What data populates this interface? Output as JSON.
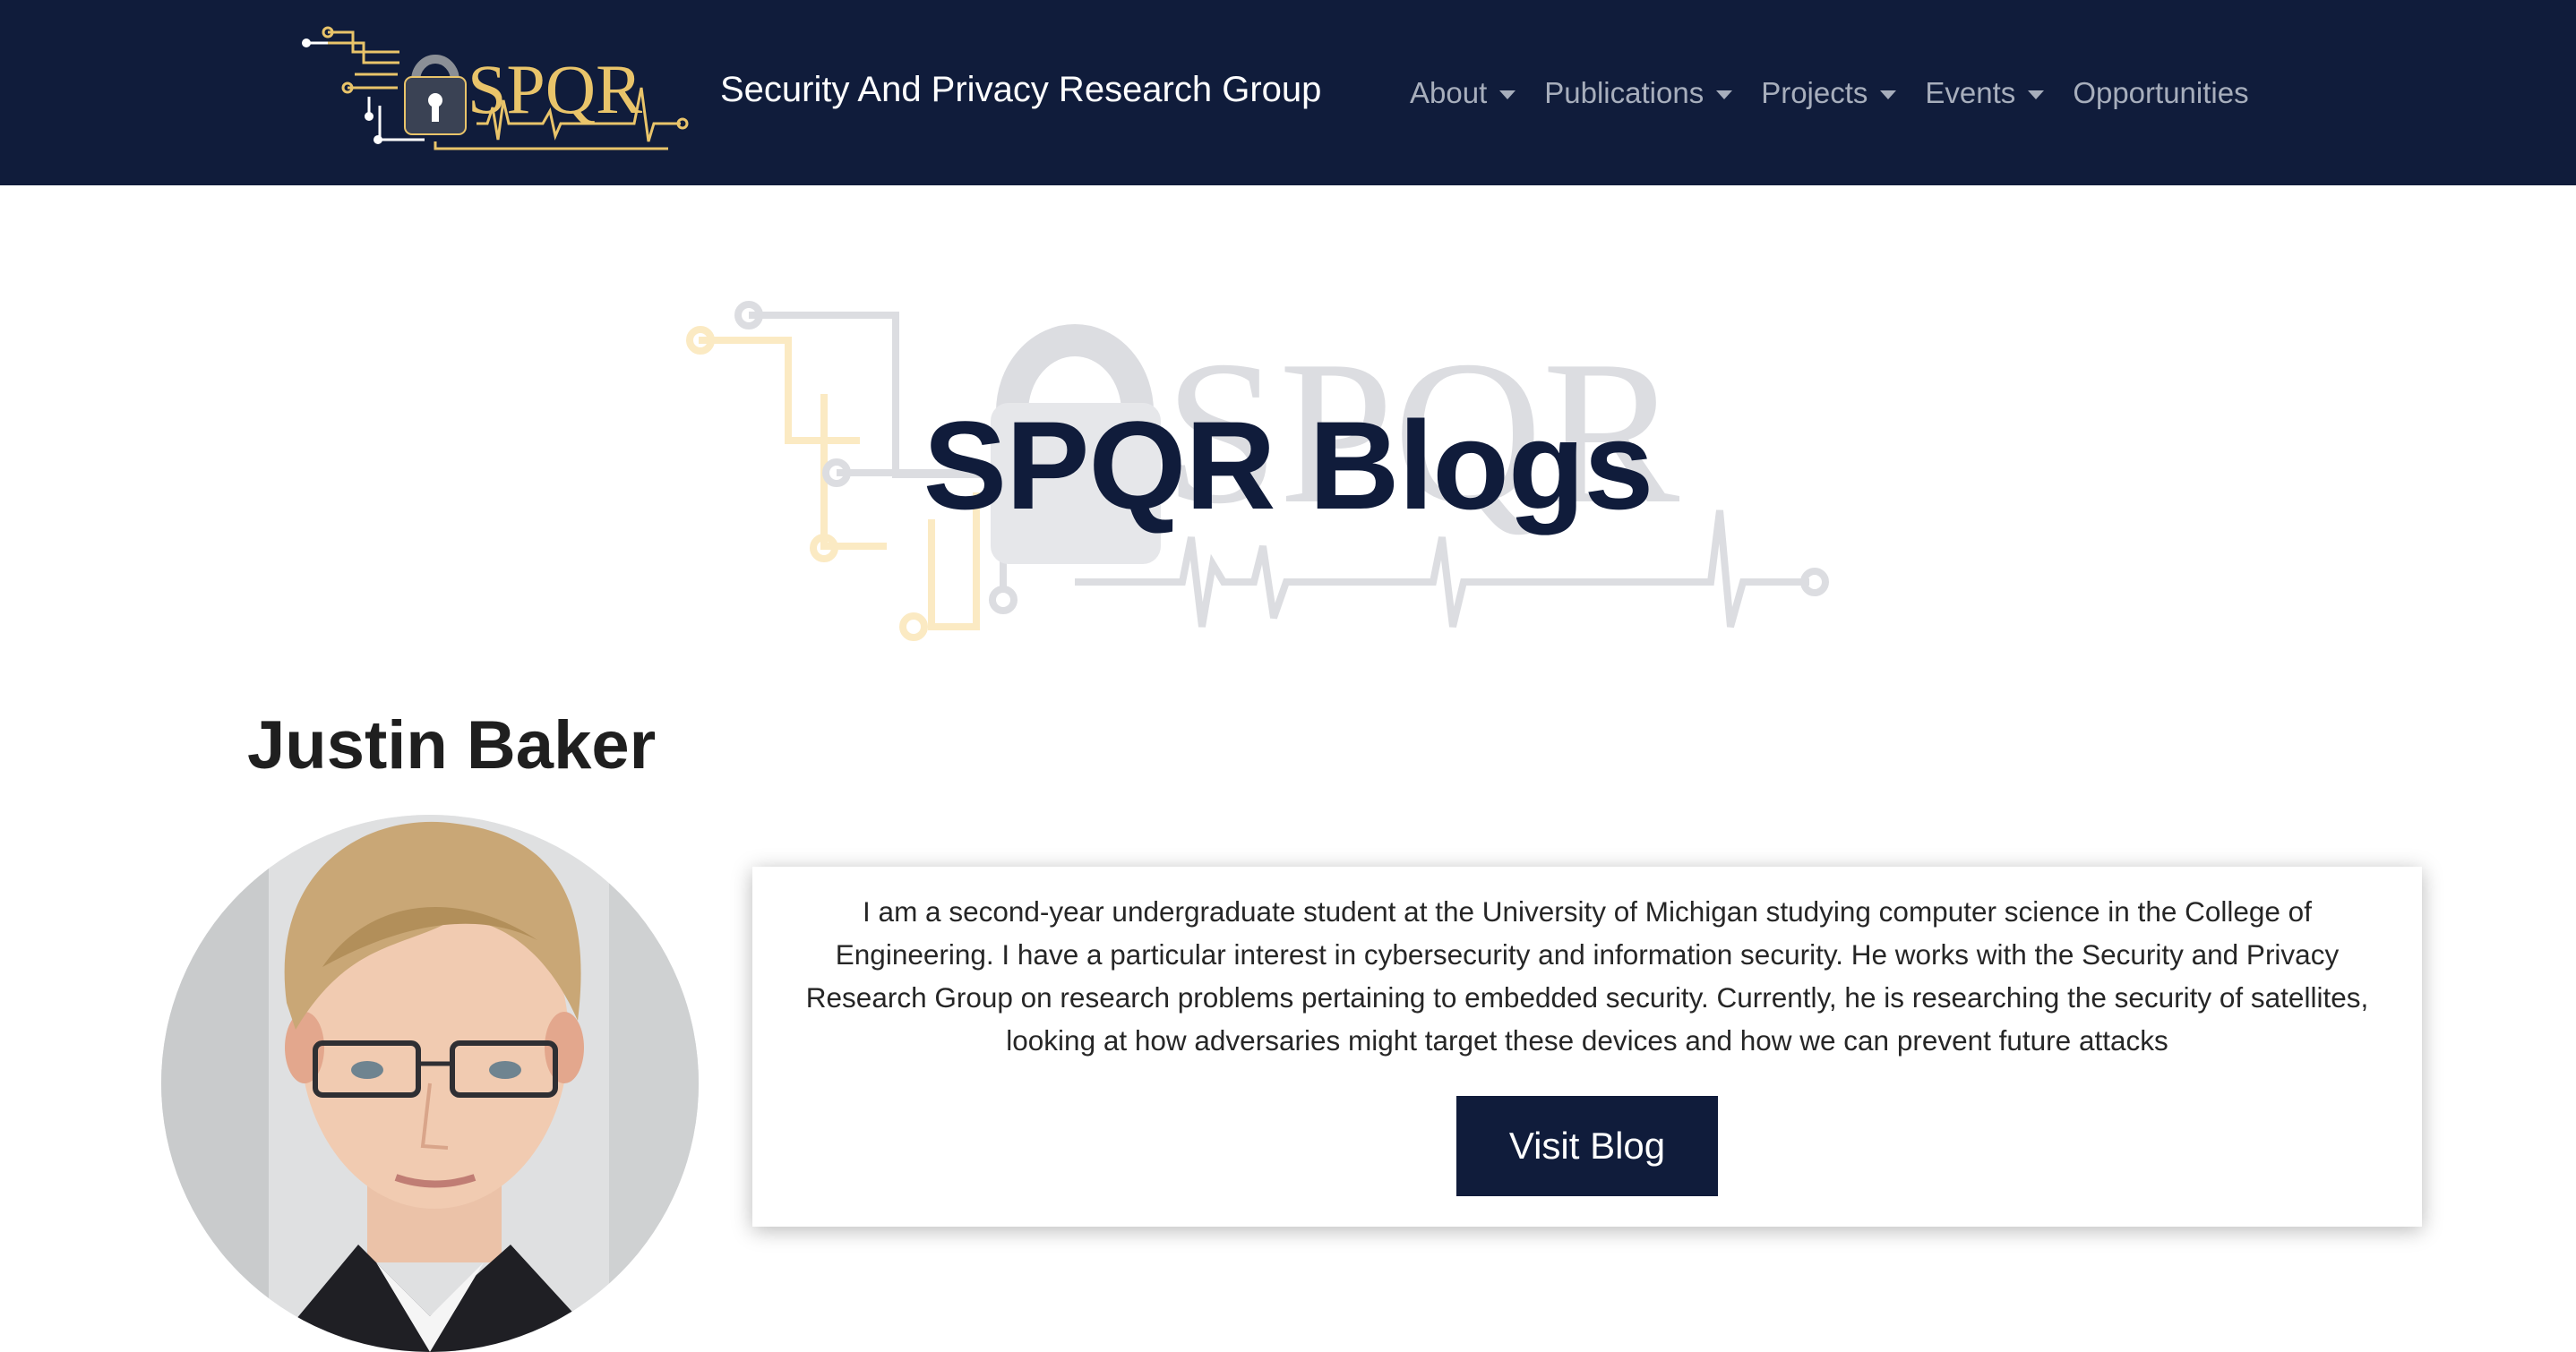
{
  "header": {
    "logo_text": "SPQR",
    "site_title": "Security And Privacy Research Group",
    "nav": [
      {
        "label": "About",
        "dropdown": true
      },
      {
        "label": "Publications",
        "dropdown": true
      },
      {
        "label": "Projects",
        "dropdown": true
      },
      {
        "label": "Events",
        "dropdown": true
      },
      {
        "label": "Opportunities",
        "dropdown": false
      }
    ]
  },
  "hero": {
    "title": "SPQR Blogs",
    "watermark_text": "SPQR"
  },
  "blog_entry": {
    "name": "Justin Baker",
    "bio": "I am a second-year undergraduate student at the University of Michigan studying computer science in the College of Engineering. I have a particular interest in cybersecurity and information security. He works with the Security and Privacy Research Group on research problems pertaining to embedded security. Currently, he is researching the security of satellites, looking at how adversaries might target these devices and how we can prevent future attacks",
    "button_label": "Visit Blog"
  },
  "colors": {
    "navy": "#101c3b",
    "gold": "#e9c46a",
    "nav_text": "#a7aebc"
  }
}
